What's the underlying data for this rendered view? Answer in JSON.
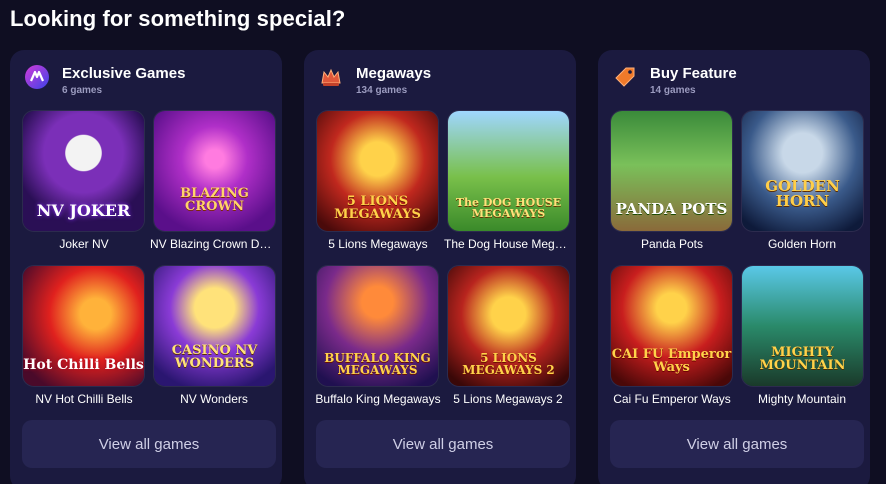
{
  "page": {
    "heading": "Looking for something special?"
  },
  "sections": [
    {
      "title": "Exclusive Games",
      "count": "6 games",
      "icon": "nv-logo-icon",
      "view_all": "View all games",
      "games": [
        {
          "name": "Joker NV",
          "tile_text": "NV JOKER"
        },
        {
          "name": "NV Blazing Crown Deluxe",
          "tile_text": "BLAZING CROWN"
        },
        {
          "name": "NV Hot Chilli Bells",
          "tile_text": "Hot Chilli Bells"
        },
        {
          "name": "NV Wonders",
          "tile_text": "CASINO NV WONDERS"
        }
      ]
    },
    {
      "title": "Megaways",
      "count": "134 games",
      "icon": "crown-icon",
      "view_all": "View all games",
      "games": [
        {
          "name": "5 Lions Megaways",
          "tile_text": "5 LIONS MEGAWAYS"
        },
        {
          "name": "The Dog House Megaways",
          "tile_text": "The DOG HOUSE MEGAWAYS"
        },
        {
          "name": "Buffalo King Megaways",
          "tile_text": "BUFFALO KING MEGAWAYS"
        },
        {
          "name": "5 Lions Megaways 2",
          "tile_text": "5 LIONS MEGAWAYS 2"
        }
      ]
    },
    {
      "title": "Buy Feature",
      "count": "14 games",
      "icon": "price-tag-icon",
      "view_all": "View all games",
      "games": [
        {
          "name": "Panda Pots",
          "tile_text": "PANDA POTS"
        },
        {
          "name": "Golden Horn",
          "tile_text": "GOLDEN HORN"
        },
        {
          "name": "Cai Fu Emperor Ways",
          "tile_text": "CAI FU Emperor Ways"
        },
        {
          "name": "Mighty Mountain",
          "tile_text": "MIGHTY MOUNTAIN"
        }
      ]
    }
  ],
  "colors": {
    "page_bg": "#0f0e22",
    "panel_bg": "#1b1a3f",
    "button_bg": "#262552"
  }
}
